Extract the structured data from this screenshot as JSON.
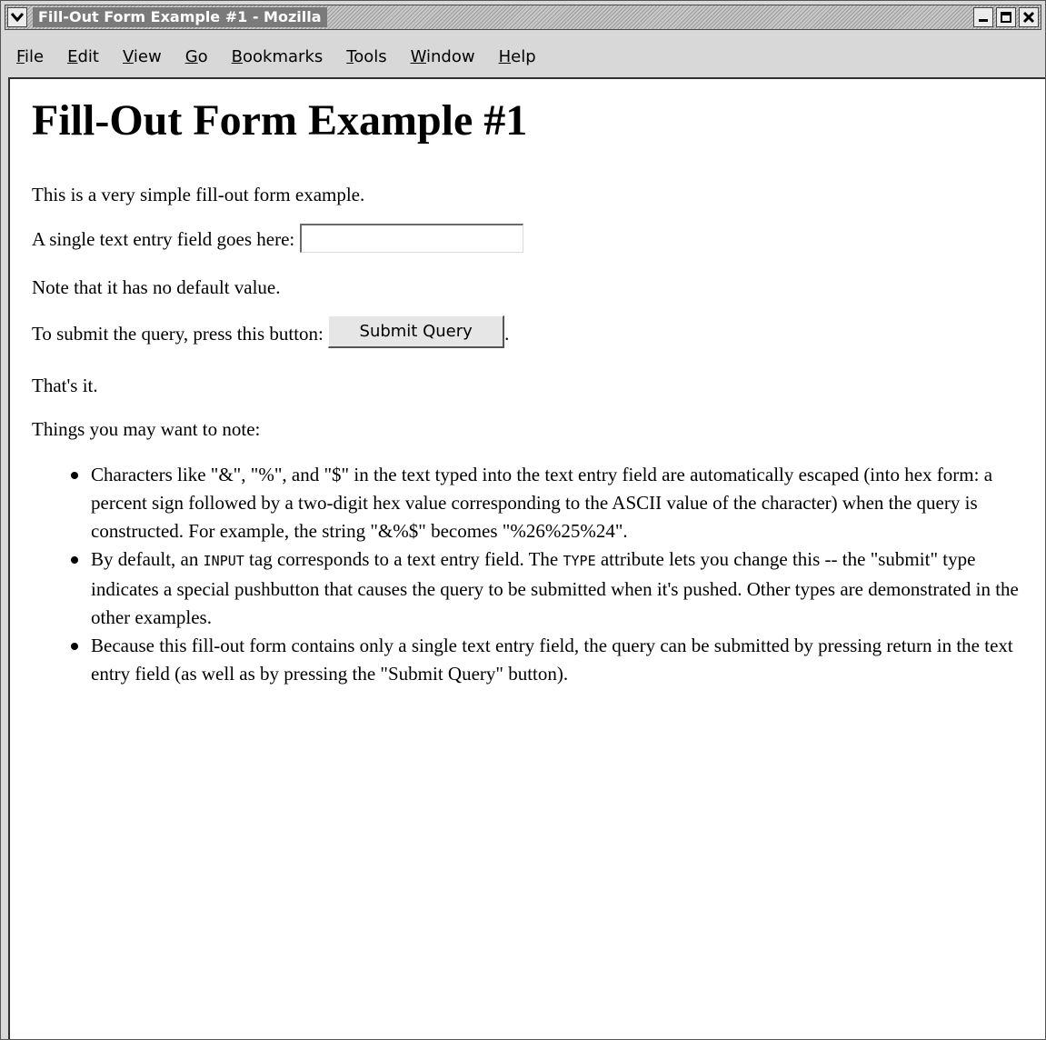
{
  "window": {
    "title": "Fill-Out Form Example #1 - Mozilla"
  },
  "menubar": {
    "items": [
      {
        "mnemonic": "F",
        "rest": "ile"
      },
      {
        "mnemonic": "E",
        "rest": "dit"
      },
      {
        "mnemonic": "V",
        "rest": "iew"
      },
      {
        "mnemonic": "G",
        "rest": "o"
      },
      {
        "mnemonic": "B",
        "rest": "ookmarks"
      },
      {
        "mnemonic": "T",
        "rest": "ools"
      },
      {
        "mnemonic": "W",
        "rest": "indow"
      },
      {
        "mnemonic": "H",
        "rest": "elp"
      }
    ]
  },
  "page": {
    "heading": "Fill-Out Form Example #1",
    "intro": "This is a very simple fill-out form example.",
    "field_label": "A single text entry field goes here: ",
    "field_value": "",
    "note": "Note that it has no default value.",
    "submit_prompt": "To submit the query, press this button: ",
    "submit_label": "Submit Query",
    "submit_suffix": ".",
    "thats_it": "That's it.",
    "things_note": "Things you may want to note:",
    "bullets": {
      "b1": "Characters like \"&\", \"%\", and \"$\" in the text typed into the text entry field are automatically escaped (into hex form: a percent sign followed by a two-digit hex value corresponding to the ASCII value of the character) when the query is constructed. For example, the string \"&%$\" becomes \"%26%25%24\".",
      "b2_part1": "By default, an ",
      "b2_code1": "INPUT",
      "b2_part2": " tag corresponds to a text entry field. The ",
      "b2_code2": "TYPE",
      "b2_part3": " attribute lets you change this -- the \"submit\" type indicates a special pushbutton that causes the query to be submitted when it's pushed. Other types are demonstrated in the other examples.",
      "b3": "Because this fill-out form contains only a single text entry field, the query can be submitted by pressing return in the text entry field (as well as by pressing the \"Submit Query\" button)."
    }
  },
  "icons": {
    "window_menu": "chevron-down-icon",
    "minimize": "minimize-icon",
    "maximize": "maximize-icon",
    "close": "close-icon"
  }
}
